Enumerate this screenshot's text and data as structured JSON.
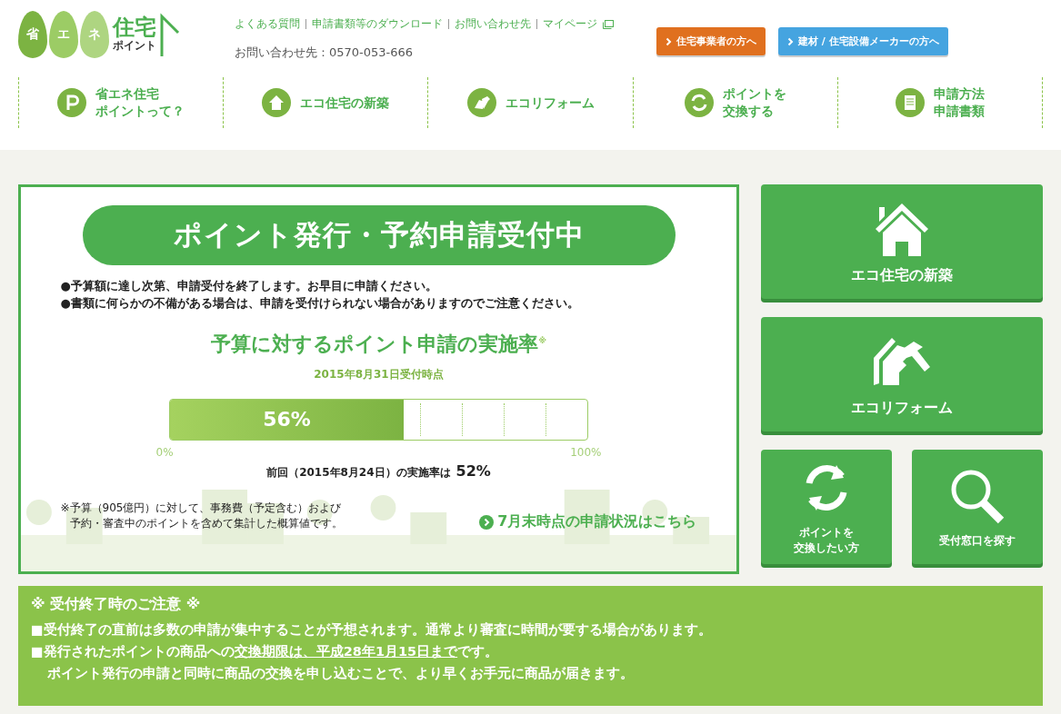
{
  "logo": {
    "leaves": [
      "省",
      "エ",
      "ネ"
    ],
    "title": "住宅",
    "subtitle": "ポイント"
  },
  "header_links": [
    "よくある質問",
    "申請書類等のダウンロード",
    "お問い合わせ先",
    "マイページ"
  ],
  "contact": "お問い合わせ先：0570-053-666",
  "header_buttons": [
    {
      "label": "住宅事業者の方へ",
      "color": "#e0701f"
    },
    {
      "label": "建材 / 住宅設備メーカーの方へ",
      "color": "#45a4e0"
    }
  ],
  "nav": [
    {
      "lines": [
        "省エネ住宅",
        "ポイントって？"
      ],
      "kind": "p"
    },
    {
      "lines": [
        "エコ住宅の新築"
      ],
      "kind": "house"
    },
    {
      "lines": [
        "エコリフォーム"
      ],
      "kind": "hammer"
    },
    {
      "lines": [
        "ポイントを",
        "交換する"
      ],
      "kind": "cycle"
    },
    {
      "lines": [
        "申請方法",
        "申請書類"
      ],
      "kind": "doc"
    }
  ],
  "status_banner": "ポイント発行・予約申請受付中",
  "notes": [
    "●予算額に達し次第、申請受付を終了します。お早目に申請ください。",
    "●書類に何らかの不備がある場合は、申請を受付けられない場合がありますのでご注意ください。"
  ],
  "rate_title": "予算に対するポイント申請の実施率$^{※}$",
  "as_of": "2015年8月31日受付時点",
  "progress": {
    "level": 0.56,
    "reading": "56%",
    "min_label": "0%",
    "max_label": "100%"
  },
  "previous": {
    "text": "前回（2015年8月24日）の実施率は",
    "value": "52%"
  },
  "footnote": [
    "※予算（905億円）に対して、事務費（予定含む）および",
    "予約・審査中のポイントを含めて集計した概算値です。"
  ],
  "status_link": "7月末時点の申請状況はこちら",
  "tiles": [
    {
      "lines": [
        "エコ住宅の新築"
      ],
      "kind": "house"
    },
    {
      "lines": [
        "エコリフォーム"
      ],
      "kind": "hammer"
    },
    {
      "lines": [
        "ポイントを",
        "交換したい方"
      ],
      "kind": "cycle"
    },
    {
      "lines": [
        "受付窓口を探す"
      ],
      "kind": "search"
    }
  ],
  "notice": {
    "title": "※ 受付終了時のご注意 ※",
    "items": [
      {
        "before": "■受付終了の直前は多数の申請が集中することが予想されます。通常より審査に時間が要する場合があります。"
      },
      {
        "before": "■発行されたポイントの商品への",
        "underlined": "交換期限は、平成28年1月15日まで",
        "after": "です。"
      }
    ],
    "continuation": "ポイント発行の申請と同時に商品の交換を申し込むことで、より早くお手元に商品が届きます。"
  }
}
